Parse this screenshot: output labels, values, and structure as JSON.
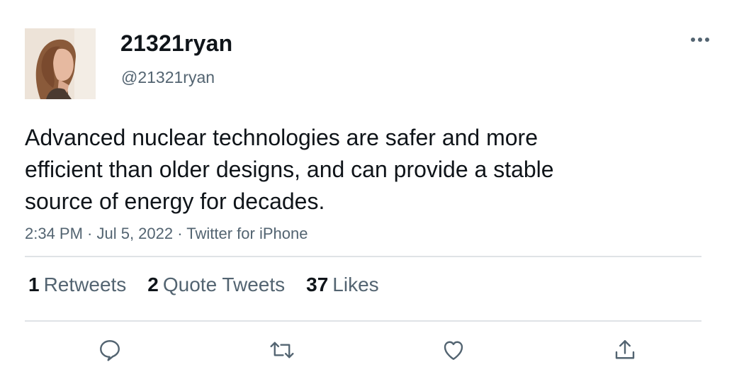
{
  "author": {
    "display_name": "21321ryan",
    "handle": "@21321ryan"
  },
  "menu": {
    "more_icon": "more-horizontal-icon"
  },
  "tweet": {
    "text_lines": [
      "Advanced nuclear technologies are safer and more",
      "efficient than older designs, and can provide a stable",
      "source of energy for decades."
    ],
    "meta": "2:34 PM · Jul 5, 2022 · Twitter for iPhone"
  },
  "stats": {
    "retweets": {
      "count": "1",
      "label": "Retweets"
    },
    "quotes": {
      "count": "2",
      "label": "Quote Tweets"
    },
    "likes": {
      "count": "37",
      "label": "Likes"
    }
  },
  "actions": {
    "reply_icon": "reply-icon",
    "retweet_icon": "retweet-icon",
    "like_icon": "heart-icon",
    "share_icon": "share-icon"
  },
  "colors": {
    "text_primary": "#0f1419",
    "text_secondary": "#536471",
    "divider": "#dfe3e6"
  }
}
